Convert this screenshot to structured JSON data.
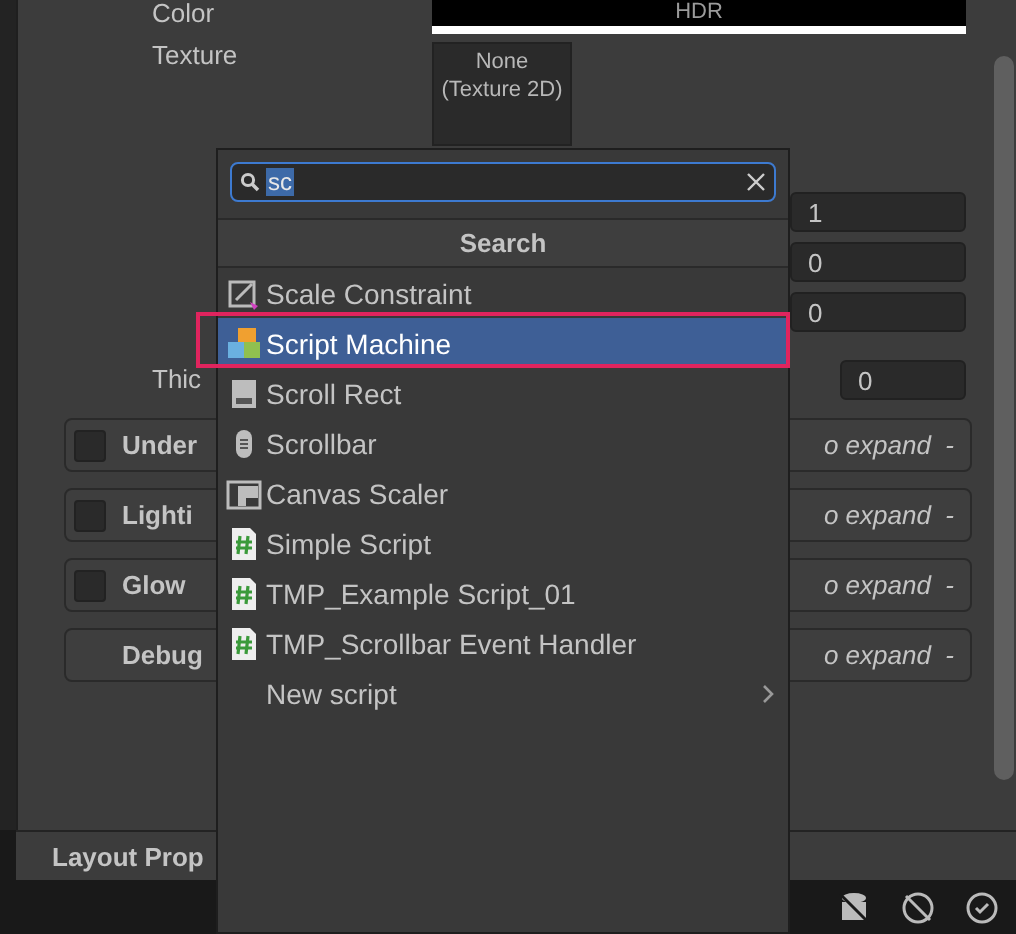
{
  "inspector": {
    "color": {
      "label": "Color",
      "value": "HDR"
    },
    "texture": {
      "label": "Texture",
      "value": "None (Texture 2D)"
    },
    "fields": [
      "1",
      "0",
      "0"
    ],
    "thickness": {
      "label": "Thic",
      "value": "0"
    },
    "foldouts": [
      {
        "kind": "toggle",
        "title": "Under",
        "hint": "o expand  -",
        "checked": false
      },
      {
        "kind": "toggle",
        "title": "Lighti",
        "hint": "o expand  -",
        "checked": false
      },
      {
        "kind": "toggle",
        "title": "Glow",
        "hint": "o expand  -",
        "checked": false
      },
      {
        "kind": "plain",
        "title": "Debug",
        "hint": "o expand  -"
      }
    ]
  },
  "layout_bar": {
    "title": "Layout Prop"
  },
  "popup": {
    "search": {
      "value": "sc"
    },
    "header": "Search",
    "items": [
      {
        "kind": "constraint",
        "label": "Scale Constraint",
        "selected": false
      },
      {
        "kind": "machine",
        "label": "Script Machine",
        "selected": true
      },
      {
        "kind": "rect",
        "label": "Scroll Rect",
        "selected": false
      },
      {
        "kind": "scrollbar",
        "label": "Scrollbar",
        "selected": false
      },
      {
        "kind": "scaler",
        "label": "Canvas Scaler",
        "selected": false
      },
      {
        "kind": "script",
        "label": "Simple Script",
        "selected": false
      },
      {
        "kind": "script",
        "label": "TMP_Example Script_01",
        "selected": false
      },
      {
        "kind": "script",
        "label": "TMP_Scrollbar Event Handler",
        "selected": false
      },
      {
        "kind": "submenu",
        "label": "New script",
        "selected": false
      }
    ]
  }
}
